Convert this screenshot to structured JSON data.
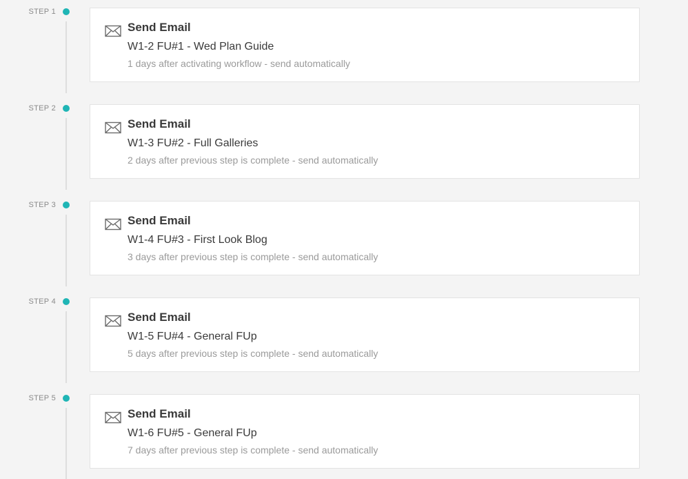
{
  "steps": [
    {
      "label": "STEP 1",
      "action": "Send Email",
      "icon": "envelope-icon",
      "name": "W1-2 FU#1 - Wed Plan Guide",
      "timing": "1 days after activating workflow - send automatically"
    },
    {
      "label": "STEP 2",
      "action": "Send Email",
      "icon": "envelope-icon",
      "name": "W1-3 FU#2 - Full Galleries",
      "timing": "2 days after previous step is complete - send automatically"
    },
    {
      "label": "STEP 3",
      "action": "Send Email",
      "icon": "envelope-icon",
      "name": "W1-4 FU#3 - First Look Blog",
      "timing": "3 days after previous step is complete - send automatically"
    },
    {
      "label": "STEP 4",
      "action": "Send Email",
      "icon": "envelope-icon",
      "name": "W1-5 FU#4 - General FUp",
      "timing": "5 days after previous step is complete - send automatically"
    },
    {
      "label": "STEP 5",
      "action": "Send Email",
      "icon": "envelope-icon",
      "name": "W1-6 FU#5 - General FUp",
      "timing": "7 days after previous step is complete - send automatically"
    }
  ],
  "colors": {
    "accent": "#1fb5b5",
    "background": "#f4f4f4",
    "card": "#ffffff",
    "text_primary": "#3a3a3a",
    "text_muted": "#9a9a9a"
  }
}
